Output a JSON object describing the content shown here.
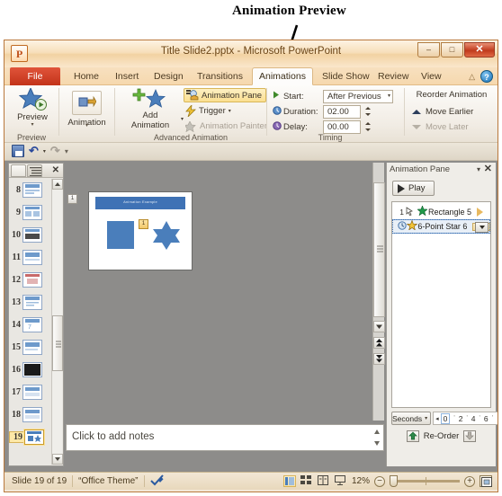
{
  "annotation": {
    "label": "Animation Preview"
  },
  "window": {
    "title": "Title Slide2.pptx  -  Microsoft PowerPoint",
    "logo": "P",
    "buttons": [
      {
        "name": "minimize-button",
        "glyph": "–"
      },
      {
        "name": "restore-button",
        "glyph": "□"
      },
      {
        "name": "close-button",
        "glyph": "✕"
      }
    ]
  },
  "ribbon": {
    "file_tab": "File",
    "tabs": [
      {
        "label": "Home",
        "active": false
      },
      {
        "label": "Insert",
        "active": false
      },
      {
        "label": "Design",
        "active": false
      },
      {
        "label": "Transitions",
        "active": false
      },
      {
        "label": "Animations",
        "active": true
      },
      {
        "label": "Slide Show",
        "active": false
      },
      {
        "label": "Review",
        "active": false
      },
      {
        "label": "View",
        "active": false
      }
    ],
    "minimize_ribbon_icon": "△",
    "help_icon": "?",
    "groups": {
      "preview": {
        "label": "Preview",
        "button_label": "Preview"
      },
      "animation": {
        "label": "",
        "button_label": "Animation"
      },
      "advanced": {
        "label": "Advanced Animation",
        "add_animation_label": "Add\nAnimation",
        "animation_pane_label": "Animation Pane",
        "trigger_label": "Trigger",
        "animation_painter_label": "Animation Painter"
      },
      "timing": {
        "label": "Timing",
        "start_label": "Start:",
        "start_value": "After Previous",
        "duration_label": "Duration:",
        "duration_value": "02.00",
        "delay_label": "Delay:",
        "delay_value": "00.00"
      },
      "reorder": {
        "title": "Reorder Animation",
        "move_earlier": "Move Earlier",
        "move_later": "Move Later"
      }
    }
  },
  "quick_access": {
    "save": "save-icon",
    "undo": "↶",
    "redo": "↷",
    "customize": "▾"
  },
  "slides_pane": {
    "close_glyph": "✕",
    "thumbs": [
      {
        "number": "8",
        "selected": false
      },
      {
        "number": "9",
        "selected": false
      },
      {
        "number": "10",
        "selected": false
      },
      {
        "number": "11",
        "selected": false
      },
      {
        "number": "12",
        "selected": false
      },
      {
        "number": "13",
        "selected": false
      },
      {
        "number": "14",
        "selected": false
      },
      {
        "number": "15",
        "selected": false
      },
      {
        "number": "16",
        "selected": false
      },
      {
        "number": "17",
        "selected": false
      },
      {
        "number": "18",
        "selected": false
      },
      {
        "number": "19",
        "selected": true
      }
    ]
  },
  "slide": {
    "title": "Animation Example",
    "badge_left": "1",
    "badge_star": "1"
  },
  "notes": {
    "placeholder": "Click to add notes"
  },
  "animation_pane": {
    "title": "Animation Pane",
    "caret": "▾",
    "close": "✕",
    "play_label": "Play",
    "items": [
      {
        "seq": "1",
        "name": "Rectangle 5",
        "effect": "green-star-icon",
        "marker": "triangle-outline",
        "selected": false
      },
      {
        "seq": "",
        "name": "6-Point Star 6",
        "effect": "yellow-star-icon",
        "marker": "bar",
        "selected": true
      }
    ],
    "timeline": {
      "units_label": "Seconds",
      "units_caret": "▾",
      "left_arrow": "◂",
      "right_arrow": "▸",
      "ticks": [
        "0",
        "2",
        "4",
        "6"
      ]
    },
    "reorder_label": "Re-Order"
  },
  "status_bar": {
    "slide_counter": "Slide 19 of 19",
    "theme": "“Office Theme”",
    "spellcheck_icon": "spellcheck-icon",
    "views": [
      "normal-view-icon",
      "slide-sorter-icon",
      "reading-view-icon",
      "slideshow-icon"
    ],
    "zoom_percent": "12%",
    "zoom_out": "−",
    "zoom_in": "+",
    "fit_icon": "fit-to-window-icon"
  }
}
